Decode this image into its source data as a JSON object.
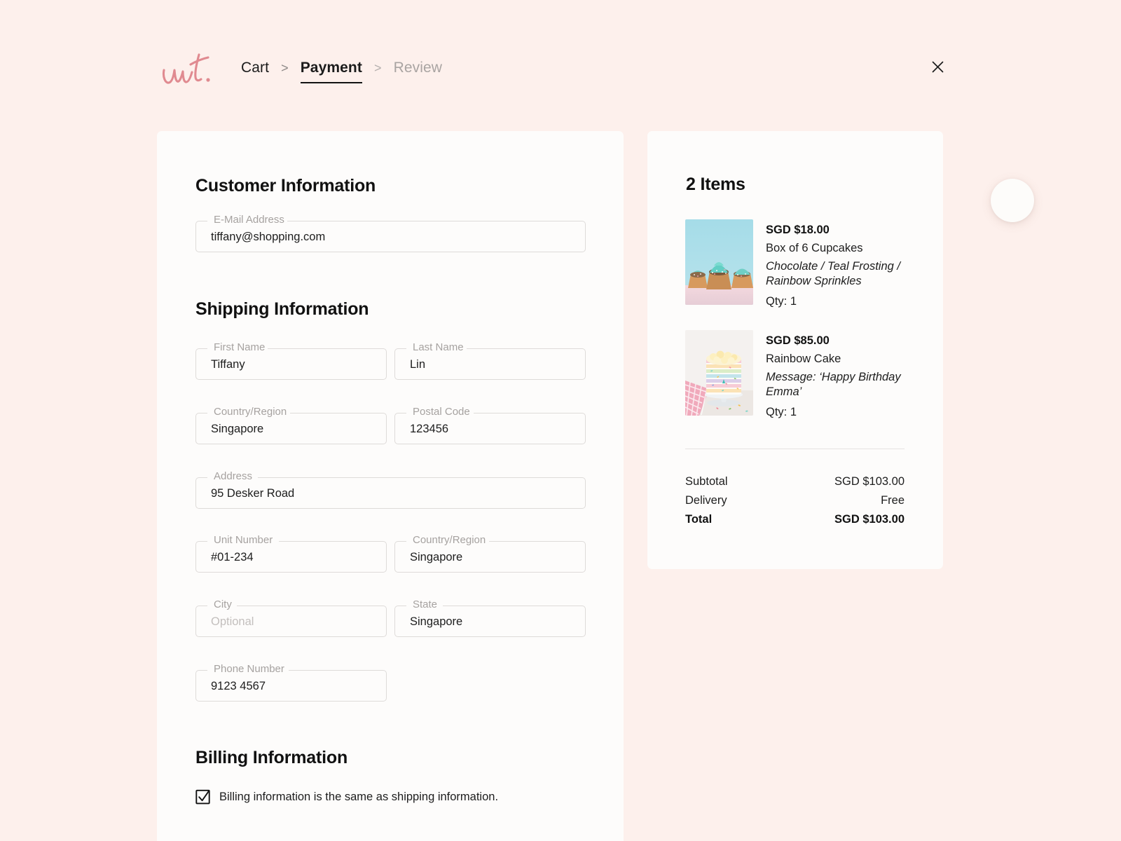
{
  "theme": {
    "page_background": "#FDF0EC",
    "card_background": "#FDFCFB",
    "logo_color": "#E08A90",
    "text_color": "#1D1D1D",
    "muted_text_color": "#A6A2A0",
    "field_border_color": "#DEDBD9"
  },
  "header": {
    "logo_text": "w.t.",
    "breadcrumb": [
      {
        "label": "Cart",
        "state": "completed"
      },
      {
        "label": "Payment",
        "state": "active"
      },
      {
        "label": "Review",
        "state": "upcoming"
      }
    ],
    "separator": ">",
    "close_label": "×"
  },
  "form": {
    "customer_section_title": "Customer Information",
    "shipping_section_title": "Shipping Information",
    "billing_section_title": "Billing Information",
    "fields": {
      "email": {
        "label": "E-Mail Address",
        "value": "tiffany@shopping.com",
        "placeholder": ""
      },
      "first_name": {
        "label": "First Name",
        "value": "Tiffany",
        "placeholder": ""
      },
      "last_name": {
        "label": "Last Name",
        "value": "Lin",
        "placeholder": ""
      },
      "country": {
        "label": "Country/Region",
        "value": "Singapore",
        "placeholder": ""
      },
      "postal": {
        "label": "Postal Code",
        "value": "123456",
        "placeholder": ""
      },
      "address": {
        "label": "Address",
        "value": "95 Desker Road",
        "placeholder": ""
      },
      "unit": {
        "label": "Unit Number",
        "value": "#01-234",
        "placeholder": ""
      },
      "country2": {
        "label": "Country/Region",
        "value": "Singapore",
        "placeholder": ""
      },
      "city": {
        "label": "City",
        "value": "",
        "placeholder": "Optional"
      },
      "state": {
        "label": "State",
        "value": "Singapore",
        "placeholder": ""
      },
      "phone": {
        "label": "Phone Number",
        "value": "9123 4567",
        "placeholder": ""
      }
    },
    "billing_checkbox": {
      "label": "Billing information is the same as shipping information.",
      "checked": true
    }
  },
  "summary": {
    "title": "2 Items",
    "items": [
      {
        "price": "SGD $18.00",
        "name": "Box of 6 Cupcakes",
        "variant": "Chocolate / Teal Frosting / Rainbow Sprinkles",
        "qty": "Qty: 1",
        "image": "cupcakes-photo"
      },
      {
        "price": "SGD $85.00",
        "name": "Rainbow Cake",
        "variant": "Message: ‘Happy Birthday Emma’",
        "qty": "Qty: 1",
        "image": "rainbow-cake-photo"
      }
    ],
    "totals": [
      {
        "label": "Subtotal",
        "value": "SGD $103.00"
      },
      {
        "label": "Delivery",
        "value": "Free"
      }
    ],
    "grand_total": {
      "label": "Total",
      "value": "SGD $103.00"
    }
  }
}
